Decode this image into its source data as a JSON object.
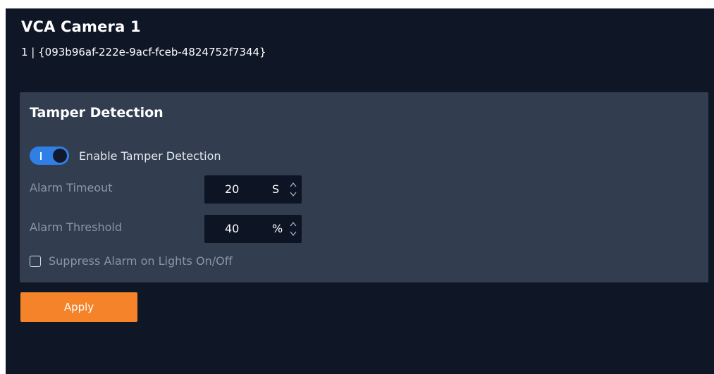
{
  "header": {
    "title": "VCA Camera 1",
    "subtitle": "1 | {093b96af-222e-9acf-fceb-4824752f7344}"
  },
  "tamper": {
    "title": "Tamper Detection",
    "enable": {
      "label": "Enable Tamper Detection",
      "checked": true
    },
    "timeout": {
      "label": "Alarm Timeout",
      "value": "20",
      "unit": "S"
    },
    "threshold": {
      "label": "Alarm Threshold",
      "value": "40",
      "unit": "%"
    },
    "suppress": {
      "label": "Suppress Alarm on Lights On/Off",
      "checked": false
    }
  },
  "actions": {
    "apply_label": "Apply"
  },
  "colors": {
    "background": "#0f1626",
    "panel": "#323e50",
    "accent": "#2f7fe6",
    "apply": "#f5832a"
  }
}
